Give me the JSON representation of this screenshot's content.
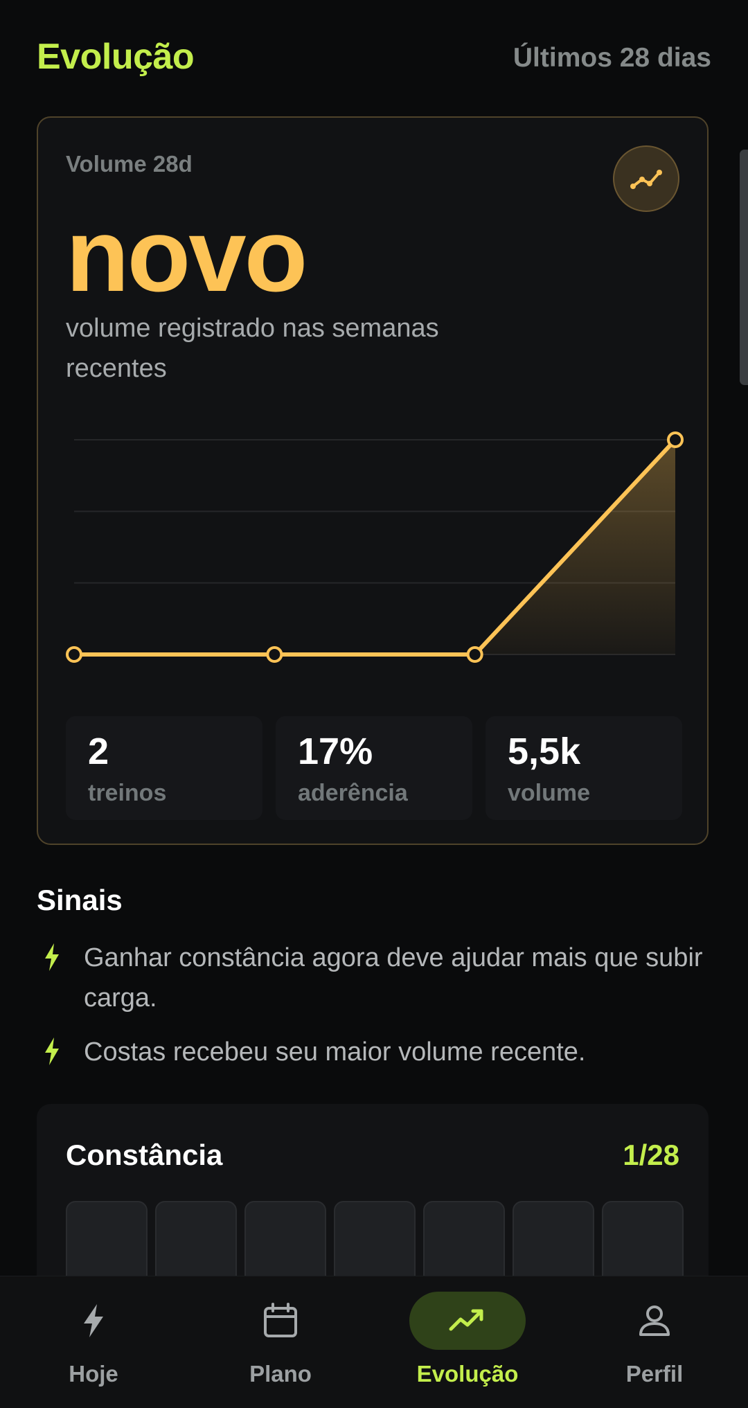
{
  "header": {
    "title": "Evolução",
    "range": "Últimos 28 dias"
  },
  "volume_card": {
    "label": "Volume 28d",
    "value": "novo",
    "subtitle": "volume registrado nas semanas recentes",
    "trend_icon": "trend-line-icon",
    "stats": [
      {
        "value": "2",
        "label": "treinos"
      },
      {
        "value": "17%",
        "label": "aderência"
      },
      {
        "value": "5,5k",
        "label": "volume"
      }
    ]
  },
  "chart_data": {
    "type": "line",
    "x": [
      1,
      2,
      3,
      4
    ],
    "series": [
      {
        "values": [
          0,
          0,
          0,
          3
        ]
      }
    ],
    "ylim": [
      0,
      3
    ],
    "grid": true,
    "color": "#fdc356"
  },
  "signals": {
    "title": "Sinais",
    "items": [
      "Ganhar constância agora deve ajudar mais que subir carga.",
      "Costas recebeu seu maior volume recente."
    ],
    "icon": "bolt-icon"
  },
  "consistency": {
    "title": "Constância",
    "count": "1/28"
  },
  "nav": {
    "items": [
      {
        "label": "Hoje",
        "icon": "bolt-icon",
        "active": false
      },
      {
        "label": "Plano",
        "icon": "calendar-icon",
        "active": false
      },
      {
        "label": "Evolução",
        "icon": "trend-up-icon",
        "active": true
      },
      {
        "label": "Perfil",
        "icon": "person-icon",
        "active": false
      }
    ]
  },
  "colors": {
    "accent": "#c3ee4c",
    "volume": "#fdc356",
    "background": "#0a0b0c"
  }
}
